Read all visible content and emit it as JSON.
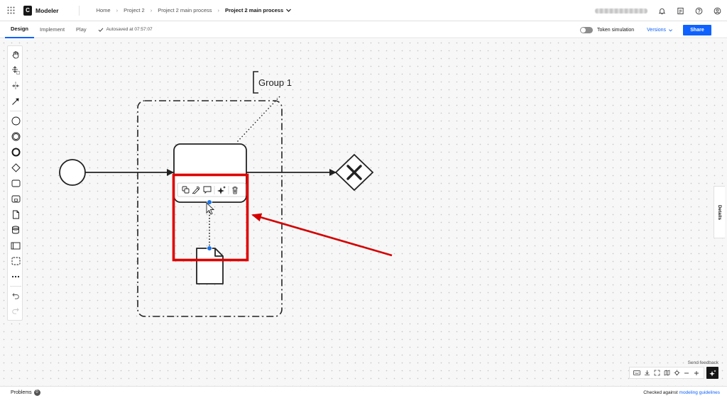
{
  "app": {
    "name": "Modeler",
    "logo_letter": "C"
  },
  "breadcrumb": {
    "items": [
      "Home",
      "Project 2",
      "Project 2 main process"
    ],
    "current": "Project 2 main process"
  },
  "tabs": [
    {
      "label": "Design",
      "active": true
    },
    {
      "label": "Implement",
      "active": false
    },
    {
      "label": "Play",
      "active": false
    }
  ],
  "autosave": {
    "text": "Autosaved at 07:57:07"
  },
  "token_simulation": {
    "label": "Token simulation",
    "enabled": false
  },
  "versions": {
    "label": "Versions"
  },
  "share": {
    "label": "Share"
  },
  "diagram": {
    "group_label": "Group 1"
  },
  "details": {
    "label": "Details"
  },
  "feedback": {
    "label": "Send feedback"
  },
  "footer": {
    "problems_label": "Problems",
    "problems_count": "0",
    "checked_prefix": "Checked against",
    "checked_link": "modeling guidelines"
  },
  "colors": {
    "accent": "#0f62fe",
    "highlight": "#e00000",
    "handle": "#1a73e8"
  }
}
